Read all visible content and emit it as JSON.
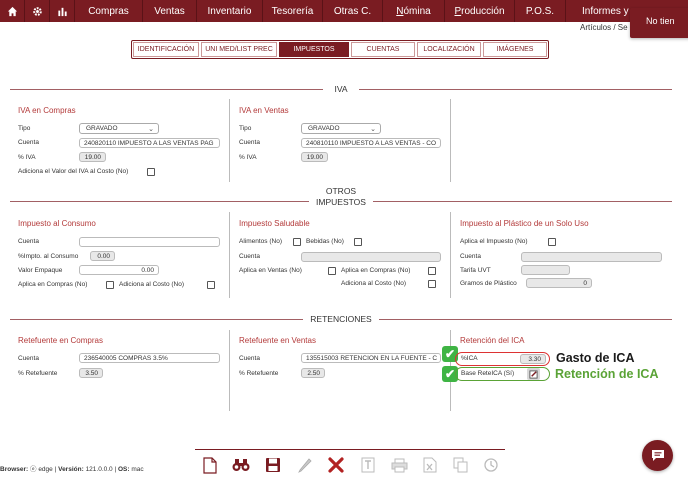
{
  "nav": {
    "items": [
      {
        "label": "Compras"
      },
      {
        "label": "Ventas"
      },
      {
        "label": "Inventario"
      },
      {
        "label": "Tesorería"
      },
      {
        "label": "Otras C."
      },
      {
        "label_pre": "",
        "label_u": "N",
        "label_post": "ómina"
      },
      {
        "label_pre": "",
        "label_u": "P",
        "label_post": "roducción"
      },
      {
        "label": "P.O.S."
      },
      {
        "label": "Informes y"
      }
    ],
    "notice": "No tien",
    "breadcrumb": "Artículos / Se"
  },
  "tabs": [
    "IDENTIFICACIÓN",
    "UNI MED/LIST PREC",
    "IMPUESTOS",
    "CUENTAS",
    "LOCALIZACIÓN",
    "IMÁGENES"
  ],
  "sections": {
    "iva": "IVA",
    "otros_1": "OTROS",
    "otros_2": "IMPUESTOS",
    "retenciones": "RETENCIONES"
  },
  "iva_compras": {
    "title": "IVA en Compras",
    "tipo_label": "Tipo",
    "tipo_value": "GRAVADO",
    "cuenta_label": "Cuenta",
    "cuenta_value": "240820110 IMPUESTO A LAS VENTAS PAG",
    "piva_label": "% IVA",
    "piva_value": "19.00",
    "adiciona_label": "Adiciona el Valor del IVA al Costo (No)"
  },
  "iva_ventas": {
    "title": "IVA en Ventas",
    "tipo_label": "Tipo",
    "tipo_value": "GRAVADO",
    "cuenta_label": "Cuenta",
    "cuenta_value": "240810110 IMPUESTO A LAS VENTAS - CO",
    "piva_label": "% IVA",
    "piva_value": "19.00"
  },
  "consumo": {
    "title": "Impuesto al Consumo",
    "cuenta_label": "Cuenta",
    "cuenta_value": "",
    "pimpto_label": "%Impto. al Consumo",
    "pimpto_value": "0.00",
    "empaque_label": "Valor Empaque",
    "empaque_value": "0.00",
    "aplica_label": "Aplica en Compras (No)",
    "adiciona_label": "Adiciona al Costo (No)"
  },
  "saludable": {
    "title": "Impuesto Saludable",
    "alimentos_label": "Alimentos (No)",
    "bebidas_label": "Bebidas (No)",
    "cuenta_label": "Cuenta",
    "cuenta_value": "",
    "aplica_ventas_label": "Aplica en Ventas (No)",
    "aplica_compras_label": "Aplica en Compras (No)",
    "adiciona_label": "Adiciona al Costo (No)"
  },
  "plastico": {
    "title": "Impuesto al Plástico de un Solo Uso",
    "aplica_label": "Aplica el Impuesto (No)",
    "cuenta_label": "Cuenta",
    "cuenta_value": "",
    "tarifa_label": "Tarifa UVT",
    "tarifa_value": "",
    "gramos_label": "Gramos de Plástico",
    "gramos_value": "0"
  },
  "retefuente_compras": {
    "title": "Retefuente en Compras",
    "cuenta_label": "Cuenta",
    "cuenta_value": "236540005 COMPRAS 3.5%",
    "pret_label": "% Retefuente",
    "pret_value": "3.50"
  },
  "retefuente_ventas": {
    "title": "Retefuente en Ventas",
    "cuenta_label": "Cuenta",
    "cuenta_value": "135515003 RETENCION EN LA FUENTE - C",
    "pret_label": "% Retefuente",
    "pret_value": "2.50"
  },
  "ica": {
    "title": "Retención del ICA",
    "pica_label": "%ICA",
    "pica_value": "3.30",
    "base_label": "Base ReteICA (Sí)",
    "anno_gasto": "Gasto de ICA",
    "anno_retencion": "Retención de ICA"
  },
  "footer": {
    "browser_label": "Browser:",
    "browser_value": "edge",
    "version_label": "Versión:",
    "version_value": "121.0.0.0",
    "os_label": "OS:",
    "os_value": "mac"
  },
  "colors": {
    "brand": "#7a1c22",
    "anno_red": "#d33333",
    "anno_green": "#5aa336"
  },
  "icons": [
    "home-icon",
    "gear-icon",
    "bar-chart-icon",
    "new-document-icon",
    "binoculars-icon",
    "save-icon",
    "edit-icon",
    "delete-icon",
    "text-icon",
    "print-icon",
    "excel-icon",
    "copy-icon",
    "history-icon",
    "chat-icon",
    "edge-icon"
  ]
}
